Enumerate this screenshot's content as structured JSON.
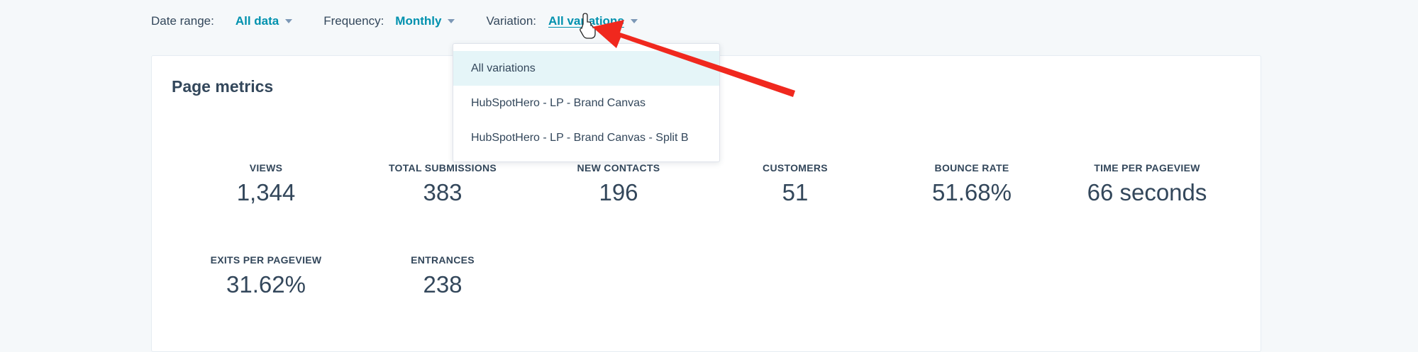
{
  "filters": {
    "date_range": {
      "label": "Date range:",
      "value": "All data"
    },
    "frequency": {
      "label": "Frequency:",
      "value": "Monthly"
    },
    "variation": {
      "label": "Variation:",
      "value": "All variations"
    }
  },
  "dropdown": {
    "options": [
      "All variations",
      "HubSpotHero - LP - Brand Canvas",
      "HubSpotHero - LP - Brand Canvas - Split B"
    ],
    "selected": "All variations"
  },
  "card": {
    "title": "Page metrics",
    "metrics": [
      {
        "label": "VIEWS",
        "value": "1,344"
      },
      {
        "label": "TOTAL SUBMISSIONS",
        "value": "383"
      },
      {
        "label": "NEW CONTACTS",
        "value": "196"
      },
      {
        "label": "CUSTOMERS",
        "value": "51"
      },
      {
        "label": "BOUNCE RATE",
        "value": "51.68%"
      },
      {
        "label": "TIME PER PAGEVIEW",
        "value": "66 seconds"
      },
      {
        "label": "EXITS PER PAGEVIEW",
        "value": "31.62%"
      },
      {
        "label": "ENTRANCES",
        "value": "238"
      }
    ]
  },
  "colors": {
    "accent": "#0091ae",
    "text": "#33475b",
    "background": "#f5f8fa",
    "selected_option_bg": "#e5f5f8",
    "annotation_arrow": "#f0281e"
  },
  "icons": {
    "caret": "caret-down-icon",
    "cursor": "hand-pointer-icon",
    "annotation": "red-arrow-annotation"
  }
}
